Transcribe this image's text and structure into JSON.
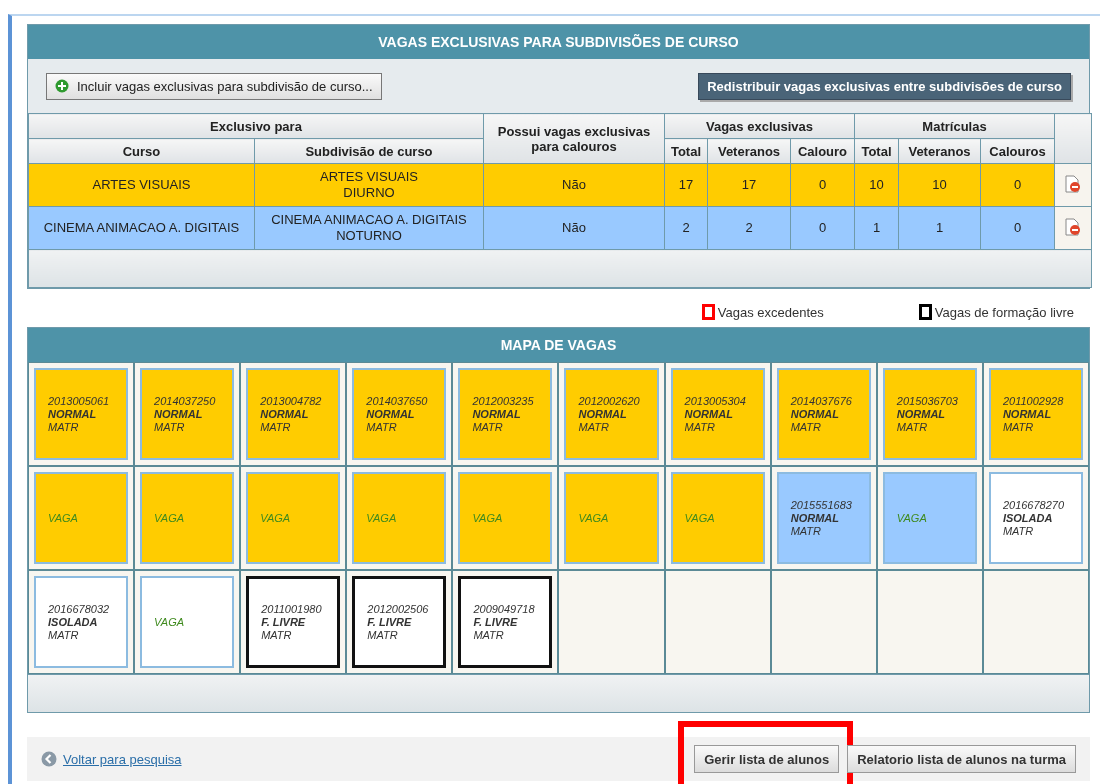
{
  "exclusive_panel": {
    "title": "VAGAS EXCLUSIVAS PARA SUBDIVISÕES DE CURSO",
    "add_button": "Incluir vagas exclusivas para subdivisão de curso...",
    "redistribute_button": "Redistribuir vagas exclusivas entre subdivisões de curso",
    "table": {
      "group_headers": [
        "Exclusivo para",
        "Possui vagas exclusivas para calouros",
        "Vagas exclusivas",
        "Matrículas"
      ],
      "columns": [
        "Curso",
        "Subdivisão de curso",
        "Total",
        "Veteranos",
        "Calouro",
        "Total",
        "Veteranos",
        "Calouros"
      ],
      "rows": [
        {
          "color": "#ffcc00",
          "curso": "ARTES VISUAIS",
          "subdivisao": [
            "ARTES VISUAIS",
            "DIURNO"
          ],
          "calouros": "Não",
          "values": [
            "17",
            "17",
            "0",
            "10",
            "10",
            "0"
          ]
        },
        {
          "color": "#99c9ff",
          "curso": "CINEMA ANIMACAO A. DIGITAIS",
          "subdivisao": [
            "CINEMA ANIMACAO A. DIGITAIS",
            "NOTURNO"
          ],
          "calouros": "Não",
          "values": [
            "2",
            "2",
            "0",
            "1",
            "1",
            "0"
          ]
        }
      ]
    }
  },
  "legend": [
    {
      "label": "Vagas excedentes",
      "color": "#ff0000"
    },
    {
      "label": "Vagas de formação livre",
      "color": "#000000"
    }
  ],
  "map": {
    "title": "MAPA DE VAGAS",
    "slots": [
      {
        "kind": "student",
        "color": "#ffcc00",
        "free_formation": false,
        "lines": [
          "2013005061",
          "NORMAL",
          "MATR"
        ]
      },
      {
        "kind": "student",
        "color": "#ffcc00",
        "free_formation": false,
        "lines": [
          "2014037250",
          "NORMAL",
          "MATR"
        ]
      },
      {
        "kind": "student",
        "color": "#ffcc00",
        "free_formation": false,
        "lines": [
          "2013004782",
          "NORMAL",
          "MATR"
        ]
      },
      {
        "kind": "student",
        "color": "#ffcc00",
        "free_formation": false,
        "lines": [
          "2014037650",
          "NORMAL",
          "MATR"
        ]
      },
      {
        "kind": "student",
        "color": "#ffcc00",
        "free_formation": false,
        "lines": [
          "2012003235",
          "NORMAL",
          "MATR"
        ]
      },
      {
        "kind": "student",
        "color": "#ffcc00",
        "free_formation": false,
        "lines": [
          "2012002620",
          "NORMAL",
          "MATR"
        ]
      },
      {
        "kind": "student",
        "color": "#ffcc00",
        "free_formation": false,
        "lines": [
          "2013005304",
          "NORMAL",
          "MATR"
        ]
      },
      {
        "kind": "student",
        "color": "#ffcc00",
        "free_formation": false,
        "lines": [
          "2014037676",
          "NORMAL",
          "MATR"
        ]
      },
      {
        "kind": "student",
        "color": "#ffcc00",
        "free_formation": false,
        "lines": [
          "2015036703",
          "NORMAL",
          "MATR"
        ]
      },
      {
        "kind": "student",
        "color": "#ffcc00",
        "free_formation": false,
        "lines": [
          "2011002928",
          "NORMAL",
          "MATR"
        ]
      },
      {
        "kind": "vacancy",
        "color": "#ffcc00",
        "free_formation": false,
        "label": "VAGA"
      },
      {
        "kind": "vacancy",
        "color": "#ffcc00",
        "free_formation": false,
        "label": "VAGA"
      },
      {
        "kind": "vacancy",
        "color": "#ffcc00",
        "free_formation": false,
        "label": "VAGA"
      },
      {
        "kind": "vacancy",
        "color": "#ffcc00",
        "free_formation": false,
        "label": "VAGA"
      },
      {
        "kind": "vacancy",
        "color": "#ffcc00",
        "free_formation": false,
        "label": "VAGA"
      },
      {
        "kind": "vacancy",
        "color": "#ffcc00",
        "free_formation": false,
        "label": "VAGA"
      },
      {
        "kind": "vacancy",
        "color": "#ffcc00",
        "free_formation": false,
        "label": "VAGA"
      },
      {
        "kind": "student",
        "color": "#99c9ff",
        "free_formation": false,
        "lines": [
          "2015551683",
          "NORMAL",
          "MATR"
        ]
      },
      {
        "kind": "vacancy",
        "color": "#99c9ff",
        "free_formation": false,
        "label": "VAGA"
      },
      {
        "kind": "student",
        "color": "#ffffff",
        "free_formation": false,
        "lines": [
          "2016678270",
          "ISOLADA",
          "MATR"
        ]
      },
      {
        "kind": "student",
        "color": "#ffffff",
        "free_formation": false,
        "lines": [
          "2016678032",
          "ISOLADA",
          "MATR"
        ]
      },
      {
        "kind": "vacancy",
        "color": "#ffffff",
        "free_formation": false,
        "label": "VAGA"
      },
      {
        "kind": "student",
        "color": "#ffffff",
        "free_formation": true,
        "lines": [
          "2011001980",
          "F. LIVRE",
          "MATR"
        ]
      },
      {
        "kind": "student",
        "color": "#ffffff",
        "free_formation": true,
        "lines": [
          "2012002506",
          "F. LIVRE",
          "MATR"
        ]
      },
      {
        "kind": "student",
        "color": "#ffffff",
        "free_formation": true,
        "lines": [
          "2009049718",
          "F. LIVRE",
          "MATR"
        ]
      },
      {
        "kind": "empty"
      },
      {
        "kind": "empty"
      },
      {
        "kind": "empty"
      },
      {
        "kind": "empty"
      },
      {
        "kind": "empty"
      }
    ]
  },
  "footer": {
    "back_link": "Voltar para pesquisa",
    "buttons": [
      {
        "label": "Gerir lista de alunos",
        "highlighted": true
      },
      {
        "label": "Relatorio lista de alunos na turma",
        "highlighted": false
      }
    ]
  }
}
